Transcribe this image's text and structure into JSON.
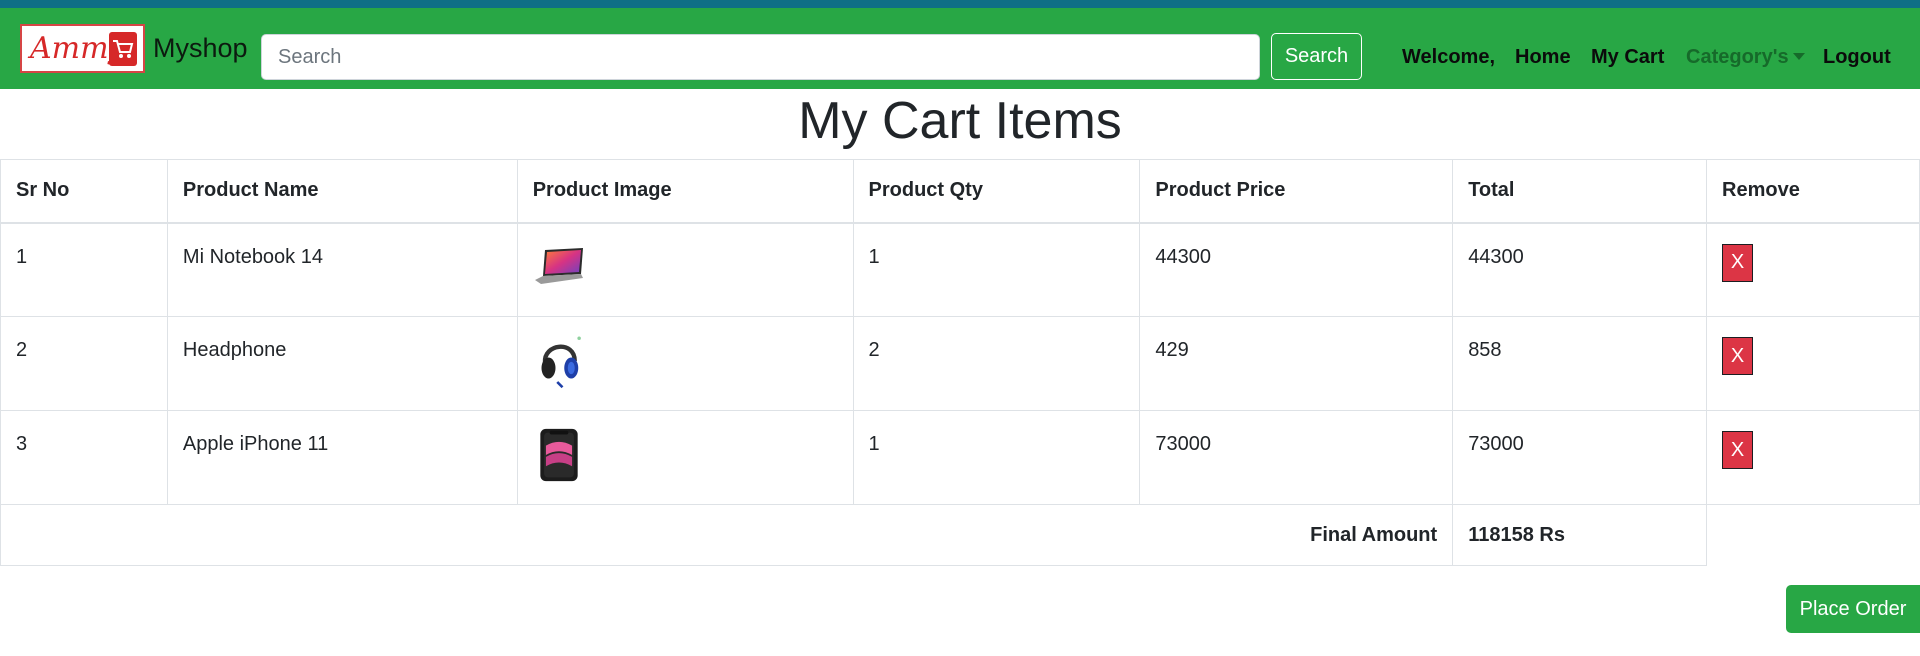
{
  "brand": {
    "logo_text": "Ammy",
    "logo_cart_icon": "shopping-cart-icon",
    "name": "Myshop"
  },
  "search": {
    "placeholder": "Search",
    "button_label": "Search"
  },
  "nav": {
    "welcome": "Welcome,",
    "home": "Home",
    "my_cart": "My Cart",
    "category": "Category's",
    "logout": "Logout"
  },
  "page": {
    "title": "My Cart Items"
  },
  "table": {
    "headers": {
      "sr_no": "Sr No",
      "product_name": "Product Name",
      "product_image": "Product Image",
      "product_qty": "Product Qty",
      "product_price": "Product Price",
      "total": "Total",
      "remove": "Remove"
    },
    "rows": [
      {
        "sr": "1",
        "name": "Mi Notebook 14",
        "image": "laptop-image",
        "qty": "1",
        "price": "44300",
        "total": "44300",
        "remove_label": "X"
      },
      {
        "sr": "2",
        "name": "Headphone",
        "image": "headphone-image",
        "qty": "2",
        "price": "429",
        "total": "858",
        "remove_label": "X"
      },
      {
        "sr": "3",
        "name": "Apple iPhone 11",
        "image": "iphone-image",
        "qty": "1",
        "price": "73000",
        "total": "73000",
        "remove_label": "X"
      }
    ],
    "final_label": "Final Amount",
    "final_value": "118158 Rs"
  },
  "actions": {
    "place_order": "Place Order"
  },
  "colors": {
    "navbar": "#28a745",
    "top_strip": "#0f6f86",
    "remove_button": "#dc3545",
    "place_order": "#28a745"
  }
}
